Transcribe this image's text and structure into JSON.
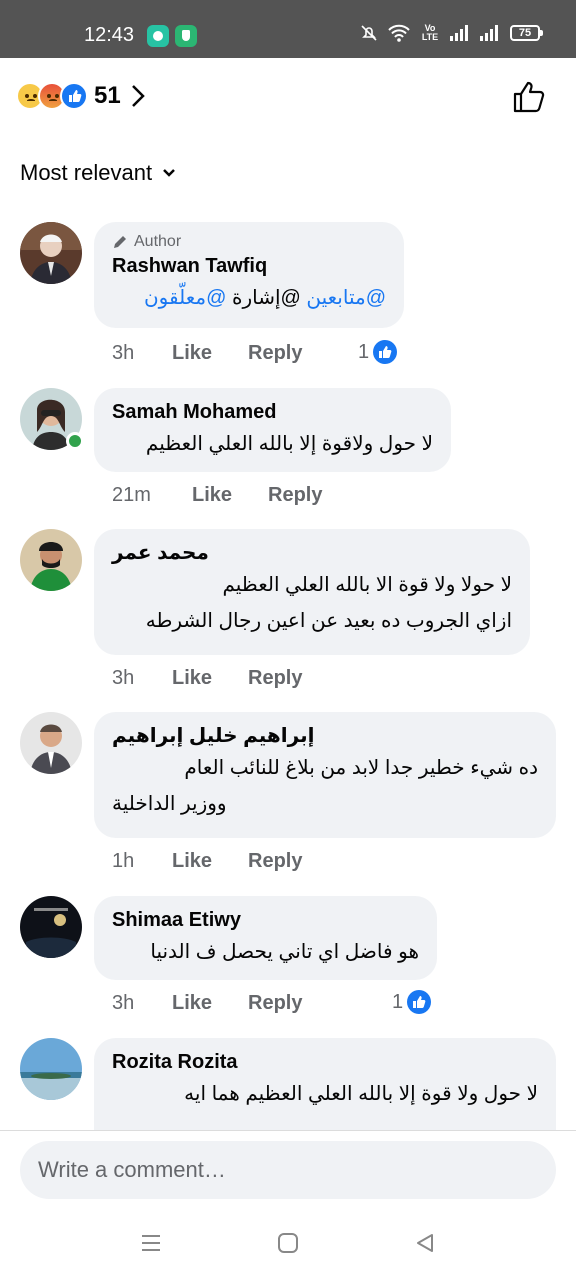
{
  "status_bar": {
    "time": "12:43",
    "battery": "75",
    "network_label": "Vo LTE"
  },
  "reactions": {
    "emojis": [
      "sad-emoji",
      "angry-emoji",
      "like-emoji"
    ],
    "count": "51"
  },
  "sort": {
    "label": "Most relevant"
  },
  "comments": [
    {
      "author_badge": "Author",
      "name": "Rashwan Tawfiq",
      "text_parts": [
        "@متابعين",
        " @إشارة ",
        "@معلّقون"
      ],
      "time": "3h",
      "like_label": "Like",
      "reply_label": "Reply",
      "likes": "1"
    },
    {
      "name": "Samah Mohamed",
      "text": "لا حول ولاقوة إلا بالله العلي العظيم",
      "time": "21m",
      "like_label": "Like",
      "reply_label": "Reply"
    },
    {
      "name": "محمد عمر",
      "text_line1": "لا حولا ولا قوة الا بالله العلي العظيم",
      "text_line2": "ازاي الجروب ده بعيد عن اعين رجال الشرطه",
      "time": "3h",
      "like_label": "Like",
      "reply_label": "Reply"
    },
    {
      "name": "إبراهيم خليل إبراهيم",
      "text_line1": "ده شيء خطير جدا لابد من بلاغ للنائب العام",
      "text_line2": "ووزير الداخلية",
      "time": "1h",
      "like_label": "Like",
      "reply_label": "Reply"
    },
    {
      "name": "Shimaa Etiwy",
      "text": "هو فاضل اي تاني يحصل ف الدنيا",
      "time": "3h",
      "like_label": "Like",
      "reply_label": "Reply",
      "likes": "1"
    },
    {
      "name": "Rozita Rozita",
      "text_line1": "لا حول ولا قوة إلا بالله العلي العظيم هما ايه"
    }
  ],
  "composer": {
    "placeholder": "Write a comment…"
  },
  "colors": {
    "status_bar": "#545454",
    "bubble": "#f0f2f5",
    "accent": "#1877f2",
    "secondary_text": "#65676b",
    "online": "#31a24c"
  }
}
